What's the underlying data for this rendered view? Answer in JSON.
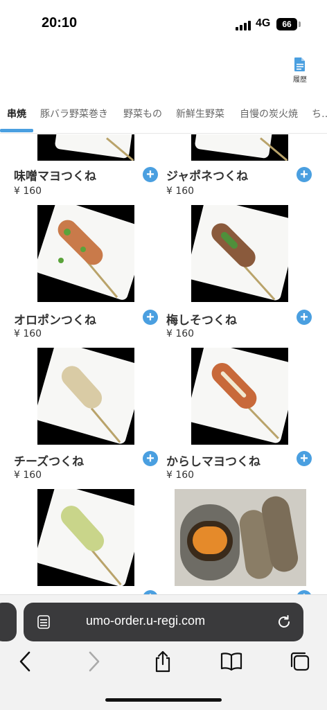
{
  "status": {
    "time": "20:10",
    "network": "4G",
    "battery": "66"
  },
  "header": {
    "history_label": "履歴"
  },
  "tabs": [
    "串焼",
    "豚バラ野菜巻き",
    "野菜もの",
    "新鮮生野菜",
    "自慢の炭火焼",
    "ち…"
  ],
  "items": [
    {
      "name": "味噌マヨつくね",
      "price": "¥ 160"
    },
    {
      "name": "ジャポネつくね",
      "price": "¥ 160"
    },
    {
      "name": "オロポンつくね",
      "price": "¥ 160"
    },
    {
      "name": "梅しそつくね",
      "price": "¥ 160"
    },
    {
      "name": "チーズつくね",
      "price": "¥ 160"
    },
    {
      "name": "からしマヨつくね",
      "price": "¥ 160"
    }
  ],
  "browser": {
    "url": "umo-order.u-regi.com"
  },
  "colors": {
    "accent": "#4a9fe0",
    "plus_button": "#4a9fe0"
  }
}
